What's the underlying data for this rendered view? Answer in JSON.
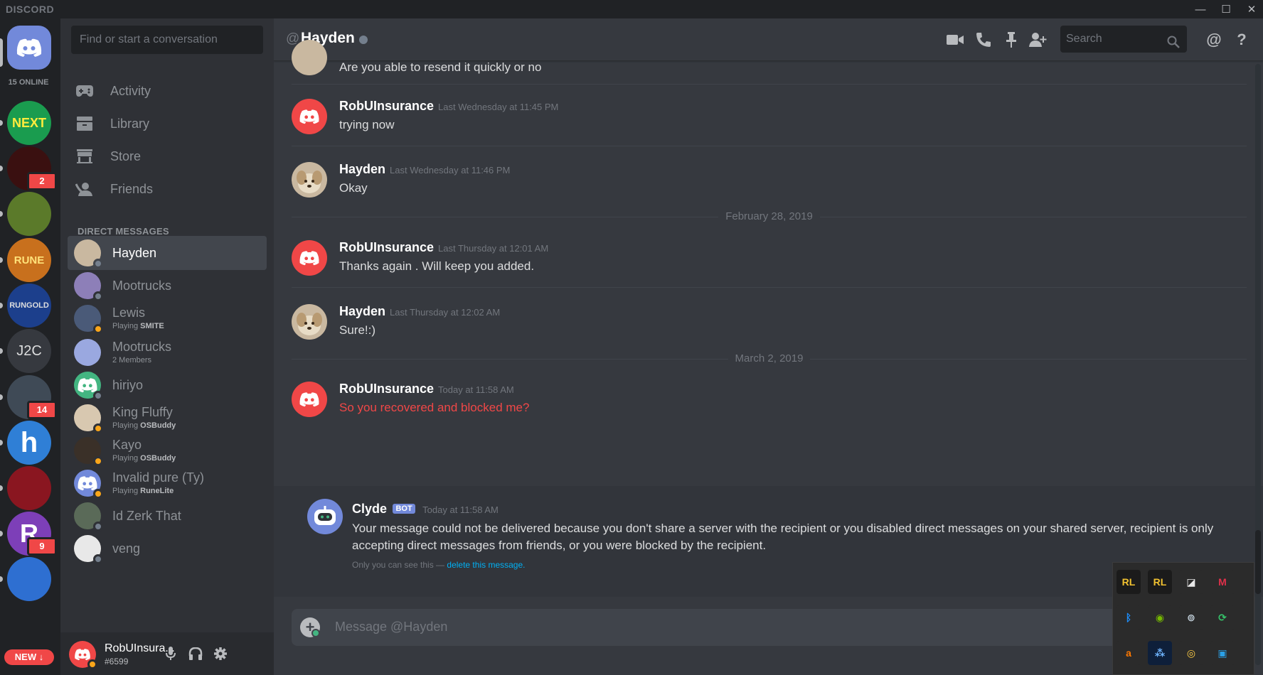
{
  "app": {
    "brand": "DISCORD"
  },
  "window_controls": {
    "minimize": "—",
    "maximize": "☐",
    "close": "✕"
  },
  "servers": {
    "online_count": "15 ONLINE",
    "items": [
      {
        "name": "next-level",
        "text": "NEXT",
        "color": "#1a9c4f"
      },
      {
        "name": "resilience",
        "text": "",
        "color": "#3a1010",
        "badge": "2"
      },
      {
        "name": "landscape",
        "text": "",
        "color": "#5b7a2a"
      },
      {
        "name": "rune-treasure",
        "text": "RUNE",
        "color": "#c8701d"
      },
      {
        "name": "rungold",
        "text": "RUNGOLD",
        "color": "#1c3f8c"
      },
      {
        "name": "j2c",
        "text": "J2C",
        "color": "#36393f"
      },
      {
        "name": "shark",
        "text": "",
        "color": "#3f4a56",
        "badge": "14"
      },
      {
        "name": "h-server",
        "text": "h",
        "color": "#2f7fd6"
      },
      {
        "name": "wheel",
        "text": "",
        "color": "#8a1620"
      },
      {
        "name": "r-server",
        "text": "R",
        "color": "#7d3fb8",
        "badge": "9"
      },
      {
        "name": "paw-server",
        "text": "",
        "color": "#2e6fd1"
      }
    ],
    "new_label": "NEW ↓"
  },
  "sidebar": {
    "search_placeholder": "Find or start a conversation",
    "nav": [
      "Activity",
      "Library",
      "Store",
      "Friends"
    ],
    "dm_header": "DIRECT MESSAGES",
    "dms": [
      {
        "name": "Hayden",
        "sub": "",
        "game": "",
        "status": "#747f8d",
        "avatar": "#c9b8a0",
        "active": true
      },
      {
        "name": "Mootrucks",
        "sub": "",
        "game": "",
        "status": "#747f8d",
        "avatar": "#8d7fb8"
      },
      {
        "name": "Lewis",
        "sub": "Playing ",
        "game": "SMITE",
        "status": "#faa61a",
        "avatar": "#4a5a78"
      },
      {
        "name": "Mootrucks",
        "sub": "2 Members",
        "game": "",
        "status": "",
        "avatar": "#9aa8e0"
      },
      {
        "name": "hiriyo",
        "sub": "",
        "game": "",
        "status": "#747f8d",
        "avatar": "#43b581"
      },
      {
        "name": "King Fluffy",
        "sub": "Playing ",
        "game": "OSBuddy",
        "status": "#faa61a",
        "avatar": "#d8c8b0"
      },
      {
        "name": "Kayo",
        "sub": "Playing ",
        "game": "OSBuddy",
        "status": "#faa61a",
        "avatar": "#3a3028"
      },
      {
        "name": "Invalid pure (Ty)",
        "sub": "Playing ",
        "game": "RuneLite",
        "status": "#faa61a",
        "avatar": "#7289da"
      },
      {
        "name": "Id Zerk That",
        "sub": "",
        "game": "",
        "status": "#747f8d",
        "avatar": "#5a6a58"
      },
      {
        "name": "veng",
        "sub": "",
        "game": "",
        "status": "#747f8d",
        "avatar": "#e8e8e8"
      }
    ]
  },
  "user_panel": {
    "name": "RobUInsura...",
    "tag": "#6599"
  },
  "chat": {
    "header": {
      "at": "@",
      "title": "Hayden",
      "search_placeholder": "Search"
    },
    "partial_message": "Are you able to resend it quickly or no",
    "messages": [
      {
        "author": "RobUInsurance",
        "time": "Last Wednesday at 11:45 PM",
        "text": "trying now",
        "avatar": "discord-red"
      },
      {
        "author": "Hayden",
        "time": "Last Wednesday at 11:46 PM",
        "text": "Okay",
        "avatar": "hayden"
      },
      {
        "author": "RobUInsurance",
        "time": "Last Thursday at 12:01 AM",
        "text": "Thanks again . Will keep you added.",
        "avatar": "discord-red"
      },
      {
        "author": "Hayden",
        "time": "Last Thursday at 12:02 AM",
        "text": "Sure!:)",
        "avatar": "hayden"
      },
      {
        "author": "RobUInsurance",
        "time": "Today at 11:58 AM",
        "text": "So you recovered and blocked me?",
        "avatar": "discord-red",
        "failed": true
      }
    ],
    "date_dividers": [
      "February 28, 2019",
      "March 2, 2019"
    ],
    "clyde": {
      "author": "Clyde",
      "bot_tag": "BOT",
      "time": "Today at 11:58 AM",
      "text": "Your message could not be delivered because you don't share a server with the recipient or you disabled direct messages on your shared server, recipient is only accepting direct messages from friends, or you were blocked by the recipient.",
      "note": "Only you can see this — ",
      "delete_link": "delete this message."
    },
    "composer_placeholder": "Message @Hayden"
  },
  "tray": {
    "icons": [
      "riot-client-icon",
      "riot-client-icon",
      "game-launcher-icon",
      "malwarebytes-icon",
      "bluetooth-icon",
      "nvidia-icon",
      "steam-icon",
      "sync-icon",
      "avast-icon",
      "stars-app-icon",
      "chrome-icon",
      "network-app-icon"
    ]
  },
  "colors": {
    "accent": "#7289da",
    "danger": "#f04747",
    "online": "#43b581",
    "idle": "#faa61a",
    "offline": "#747f8d",
    "link": "#00b0f4"
  }
}
